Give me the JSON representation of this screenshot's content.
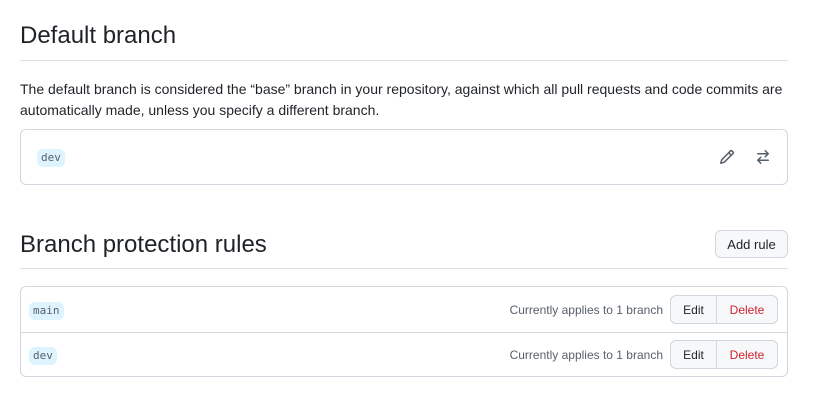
{
  "default_branch": {
    "title": "Default branch",
    "description": "The default branch is considered the “base” branch in your repository, against which all pull requests and code commits are automatically made, unless you specify a different branch.",
    "branch": "dev",
    "edit_icon": "pencil-icon",
    "switch_icon": "arrow-switch-icon"
  },
  "protection": {
    "title": "Branch protection rules",
    "add_rule_label": "Add rule",
    "rules": [
      {
        "branch": "main",
        "applies": "Currently applies to 1 branch",
        "edit_label": "Edit",
        "delete_label": "Delete"
      },
      {
        "branch": "dev",
        "applies": "Currently applies to 1 branch",
        "edit_label": "Edit",
        "delete_label": "Delete"
      }
    ]
  },
  "colors": {
    "delete_text": "#cf222e",
    "pill_bg": "#ddf4ff",
    "border": "#d0d7de"
  }
}
